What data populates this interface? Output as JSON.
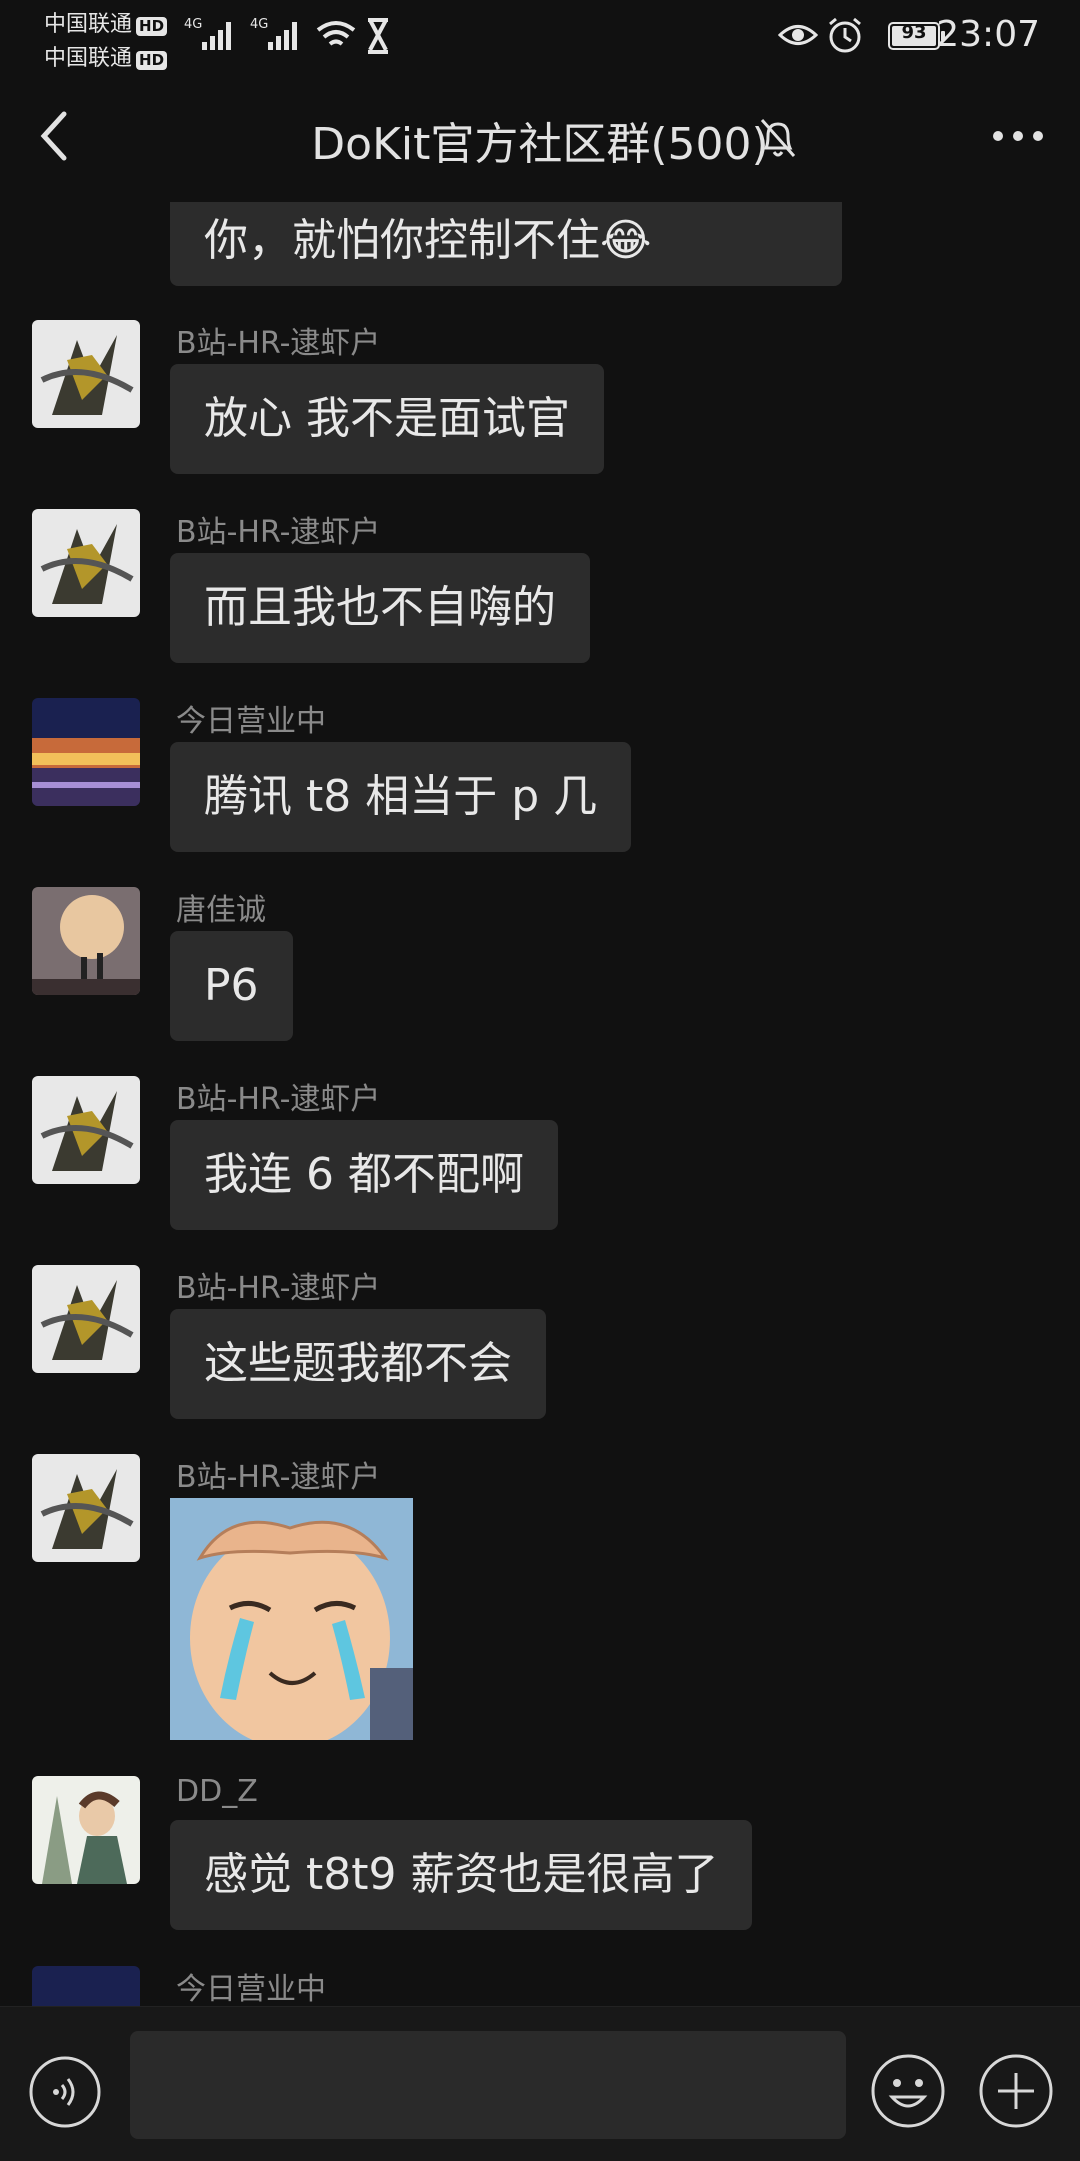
{
  "status_bar": {
    "carrier1": "中国联通",
    "carrier2": "中国联通",
    "hd": "HD",
    "net1": "4G",
    "net2": "4G",
    "battery": "93",
    "time": "23:07"
  },
  "header": {
    "title": "DoKit官方社区群(500)",
    "icons": [
      "back-icon",
      "bell-muted-icon",
      "more-icon"
    ]
  },
  "messages": [
    {
      "text": "你，就怕你控制不住😂"
    },
    {
      "sender": "B站-HR-逮虾户",
      "text": "放心  我不是面试官"
    },
    {
      "sender": "B站-HR-逮虾户",
      "text": "而且我也不自嗨的"
    },
    {
      "sender": "今日营业中",
      "text": "腾讯 t8 相当于 p 几"
    },
    {
      "sender": "唐佳诚",
      "text": "P6"
    },
    {
      "sender": "B站-HR-逮虾户",
      "text": "我连 6 都不配啊"
    },
    {
      "sender": "B站-HR-逮虾户",
      "text": "这些题我都不会"
    },
    {
      "sender": "B站-HR-逮虾户",
      "sticker": "crying-meme-sticker"
    },
    {
      "sender": "DD_Z",
      "text": "感觉 t8t9 薪资也是很高了"
    },
    {
      "sender": "今日营业中"
    }
  ],
  "input_bar": {
    "icons": [
      "voice-icon",
      "emoji-icon",
      "plus-icon"
    ]
  },
  "colors": {
    "background": "#111111",
    "bubble": "#2c2c2c",
    "sender": "#8a8a8a"
  }
}
